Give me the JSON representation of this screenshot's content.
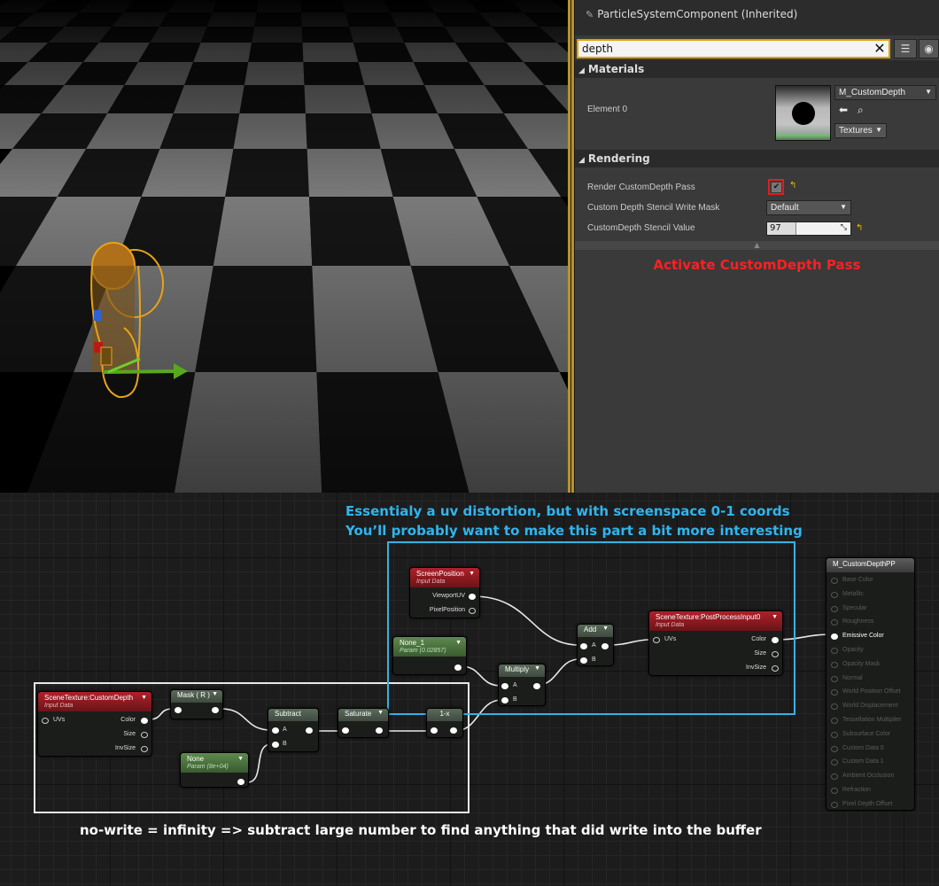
{
  "details": {
    "inherited_component": "ParticleSystemComponent (Inherited)",
    "search_value": "depth",
    "materials": {
      "header": "Materials",
      "element_label": "Element 0",
      "material_name": "M_CustomDepth",
      "textures_label": "Textures"
    },
    "rendering": {
      "header": "Rendering",
      "render_custom_depth_label": "Render CustomDepth Pass",
      "render_custom_depth_checked": true,
      "stencil_mask_label": "Custom Depth Stencil Write Mask",
      "stencil_mask_value": "Default",
      "stencil_value_label": "CustomDepth Stencil Value",
      "stencil_value": "97",
      "stencil_value_fraction": 0.35
    },
    "annotation": "Activate CustomDepth Pass"
  },
  "graph": {
    "annotation_top_line1": "Essentialy a uv distortion, but with screenspace 0-1 coords",
    "annotation_top_line2": "You’ll probably want to make this part a bit more interesting",
    "annotation_bottom": "no-write = infinity => subtract large number to find anything that did write into the buffer",
    "nodes": {
      "scene_texture_depth": {
        "title": "SceneTexture:CustomDepth",
        "subtitle": "Input Data",
        "in_uvs": "UVs",
        "out_color": "Color",
        "out_size": "Size",
        "out_invsize": "InvSize"
      },
      "mask": {
        "title": "Mask ( R )"
      },
      "none_param": {
        "title": "None",
        "subtitle": "Param (8e+04)"
      },
      "subtract": {
        "title": "Subtract",
        "in_a": "A",
        "in_b": "B"
      },
      "saturate": {
        "title": "Saturate"
      },
      "oneminus": {
        "title": "1-x"
      },
      "screen_position": {
        "title": "ScreenPosition",
        "subtitle": "Input Data",
        "out_viewport": "ViewportUV",
        "out_pixel": "PixelPosition"
      },
      "none1_param": {
        "title": "None_1",
        "subtitle": "Param (0.02857)"
      },
      "multiply": {
        "title": "Multiply",
        "in_a": "A",
        "in_b": "B"
      },
      "add": {
        "title": "Add",
        "in_a": "A",
        "in_b": "B"
      },
      "scene_texture_pp": {
        "title": "SceneTexture:PostProcessInput0",
        "subtitle": "Input Data",
        "in_uvs": "UVs",
        "out_color": "Color",
        "out_size": "Size",
        "out_invsize": "InvSize"
      },
      "result": {
        "title": "M_CustomDepthPP",
        "inputs": [
          "Base Color",
          "Metallic",
          "Specular",
          "Roughness",
          "Emissive Color",
          "Opacity",
          "Opacity Mask",
          "Normal",
          "World Position Offset",
          "World Displacement",
          "Tessellation Multiplier",
          "Subsurface Color",
          "Custom Data 0",
          "Custom Data 1",
          "Ambient Occlusion",
          "Refraction",
          "Pixel Depth Offset"
        ],
        "active_input": "Emissive Color"
      }
    }
  }
}
